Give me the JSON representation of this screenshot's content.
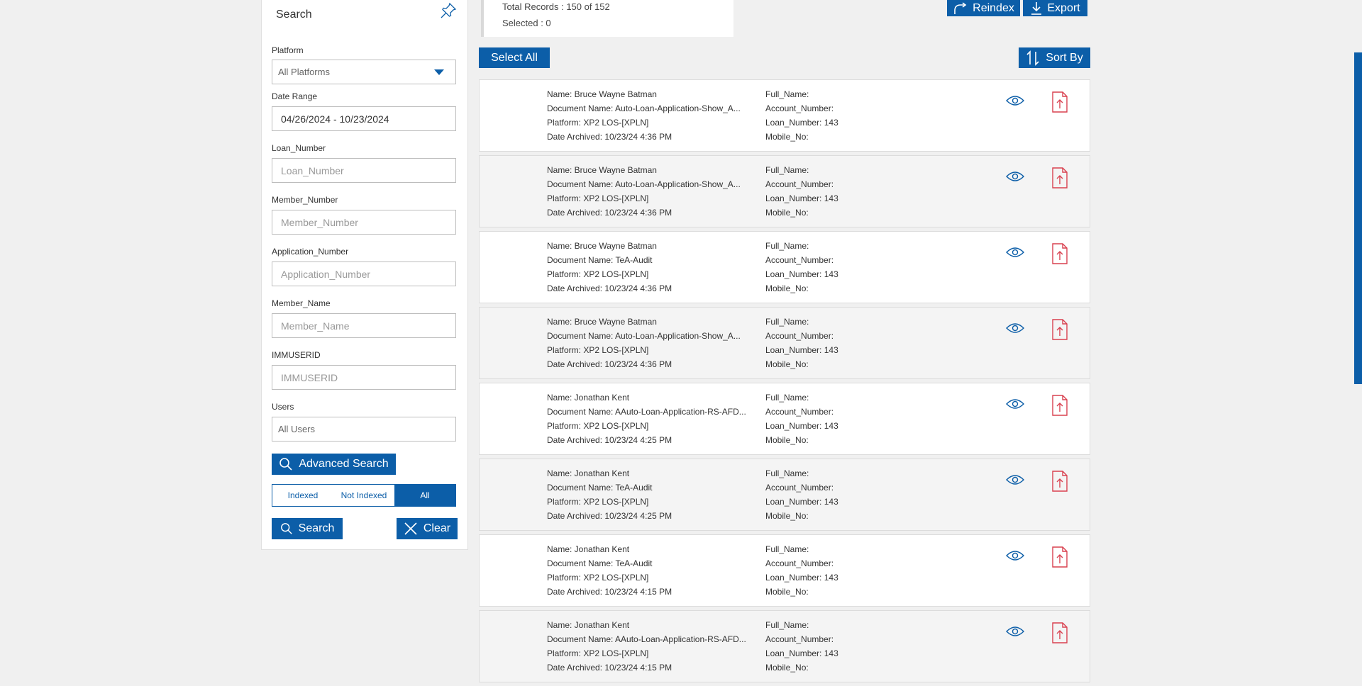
{
  "search_panel": {
    "title": "Search",
    "platform_label": "Platform",
    "platform_value": "All Platforms",
    "date_range_label": "Date Range",
    "date_range_value": "04/26/2024 - 10/23/2024",
    "loan_number_label": "Loan_Number",
    "loan_number_placeholder": "Loan_Number",
    "member_number_label": "Member_Number",
    "member_number_placeholder": "Member_Number",
    "application_number_label": "Application_Number",
    "application_number_placeholder": "Application_Number",
    "member_name_label": "Member_Name",
    "member_name_placeholder": "Member_Name",
    "immuserid_label": "IMMUSERID",
    "immuserid_placeholder": "IMMUSERID",
    "users_label": "Users",
    "users_value": "All Users",
    "advanced_search_label": "Advanced Search",
    "filter_indexed": "Indexed",
    "filter_not_indexed": "Not Indexed",
    "filter_all": "All",
    "search_button": "Search",
    "clear_button": "Clear"
  },
  "info": {
    "total_records": "Total Records : 150 of 152",
    "selected": "Selected : 0"
  },
  "toolbar": {
    "reindex_label": "Reindex",
    "export_label": "Export",
    "select_all_label": "Select All",
    "sort_by_label": "Sort By"
  },
  "colors": {
    "primary": "#0c5ea8",
    "pdf_red": "#d9404f",
    "background": "#f0f0f0"
  },
  "records": [
    {
      "name": "Name: Bruce Wayne Batman",
      "document": "Document Name: Auto-Loan-Application-Show_A...",
      "platform": "Platform: XP2 LOS-[XPLN]",
      "date": "Date Archived: 10/23/24 4:36 PM",
      "full_name": "Full_Name:",
      "account_number": "Account_Number:",
      "loan_number": "Loan_Number: 143",
      "mobile_no": "Mobile_No:"
    },
    {
      "name": "Name: Bruce Wayne Batman",
      "document": "Document Name: Auto-Loan-Application-Show_A...",
      "platform": "Platform: XP2 LOS-[XPLN]",
      "date": "Date Archived: 10/23/24 4:36 PM",
      "full_name": "Full_Name:",
      "account_number": "Account_Number:",
      "loan_number": "Loan_Number: 143",
      "mobile_no": "Mobile_No:"
    },
    {
      "name": "Name: Bruce Wayne Batman",
      "document": "Document Name: TeA-Audit",
      "platform": "Platform: XP2 LOS-[XPLN]",
      "date": "Date Archived: 10/23/24 4:36 PM",
      "full_name": "Full_Name:",
      "account_number": "Account_Number:",
      "loan_number": "Loan_Number: 143",
      "mobile_no": "Mobile_No:"
    },
    {
      "name": "Name: Bruce Wayne Batman",
      "document": "Document Name: Auto-Loan-Application-Show_A...",
      "platform": "Platform: XP2 LOS-[XPLN]",
      "date": "Date Archived: 10/23/24 4:36 PM",
      "full_name": "Full_Name:",
      "account_number": "Account_Number:",
      "loan_number": "Loan_Number: 143",
      "mobile_no": "Mobile_No:"
    },
    {
      "name": "Name: Jonathan Kent",
      "document": "Document Name: AAuto-Loan-Application-RS-AFD...",
      "platform": "Platform: XP2 LOS-[XPLN]",
      "date": "Date Archived: 10/23/24 4:25 PM",
      "full_name": "Full_Name:",
      "account_number": "Account_Number:",
      "loan_number": "Loan_Number: 143",
      "mobile_no": "Mobile_No:"
    },
    {
      "name": "Name: Jonathan Kent",
      "document": "Document Name: TeA-Audit",
      "platform": "Platform: XP2 LOS-[XPLN]",
      "date": "Date Archived: 10/23/24 4:25 PM",
      "full_name": "Full_Name:",
      "account_number": "Account_Number:",
      "loan_number": "Loan_Number: 143",
      "mobile_no": "Mobile_No:"
    },
    {
      "name": "Name: Jonathan Kent",
      "document": "Document Name: TeA-Audit",
      "platform": "Platform: XP2 LOS-[XPLN]",
      "date": "Date Archived: 10/23/24 4:15 PM",
      "full_name": "Full_Name:",
      "account_number": "Account_Number:",
      "loan_number": "Loan_Number: 143",
      "mobile_no": "Mobile_No:"
    },
    {
      "name": "Name: Jonathan Kent",
      "document": "Document Name: AAuto-Loan-Application-RS-AFD...",
      "platform": "Platform: XP2 LOS-[XPLN]",
      "date": "Date Archived: 10/23/24 4:15 PM",
      "full_name": "Full_Name:",
      "account_number": "Account_Number:",
      "loan_number": "Loan_Number: 143",
      "mobile_no": "Mobile_No:"
    }
  ]
}
